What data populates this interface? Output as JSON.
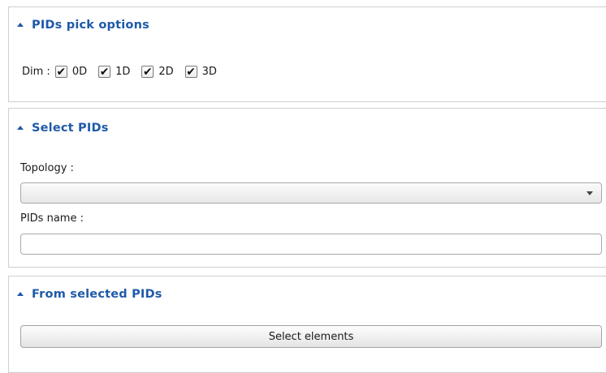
{
  "pick_options": {
    "title": "PIDs pick options",
    "dim_label": "Dim :",
    "dims": [
      {
        "label": "0D",
        "checked": true
      },
      {
        "label": "1D",
        "checked": true
      },
      {
        "label": "2D",
        "checked": true
      },
      {
        "label": "3D",
        "checked": true
      }
    ],
    "check_glyph": "✔"
  },
  "select_pids": {
    "title": "Select PIDs",
    "topology_label": "Topology :",
    "topology_value": "",
    "pids_name_label": "PIDs name :",
    "pids_name_value": ""
  },
  "from_selected": {
    "title": "From selected PIDs",
    "button_label": "Select elements"
  },
  "colors": {
    "header_text": "#1f5aa8",
    "panel_border": "#cfcfcf"
  },
  "icons": {
    "collapse": "triangle-up-icon",
    "dropdown": "chevron-down-icon",
    "check": "checkmark-icon"
  }
}
